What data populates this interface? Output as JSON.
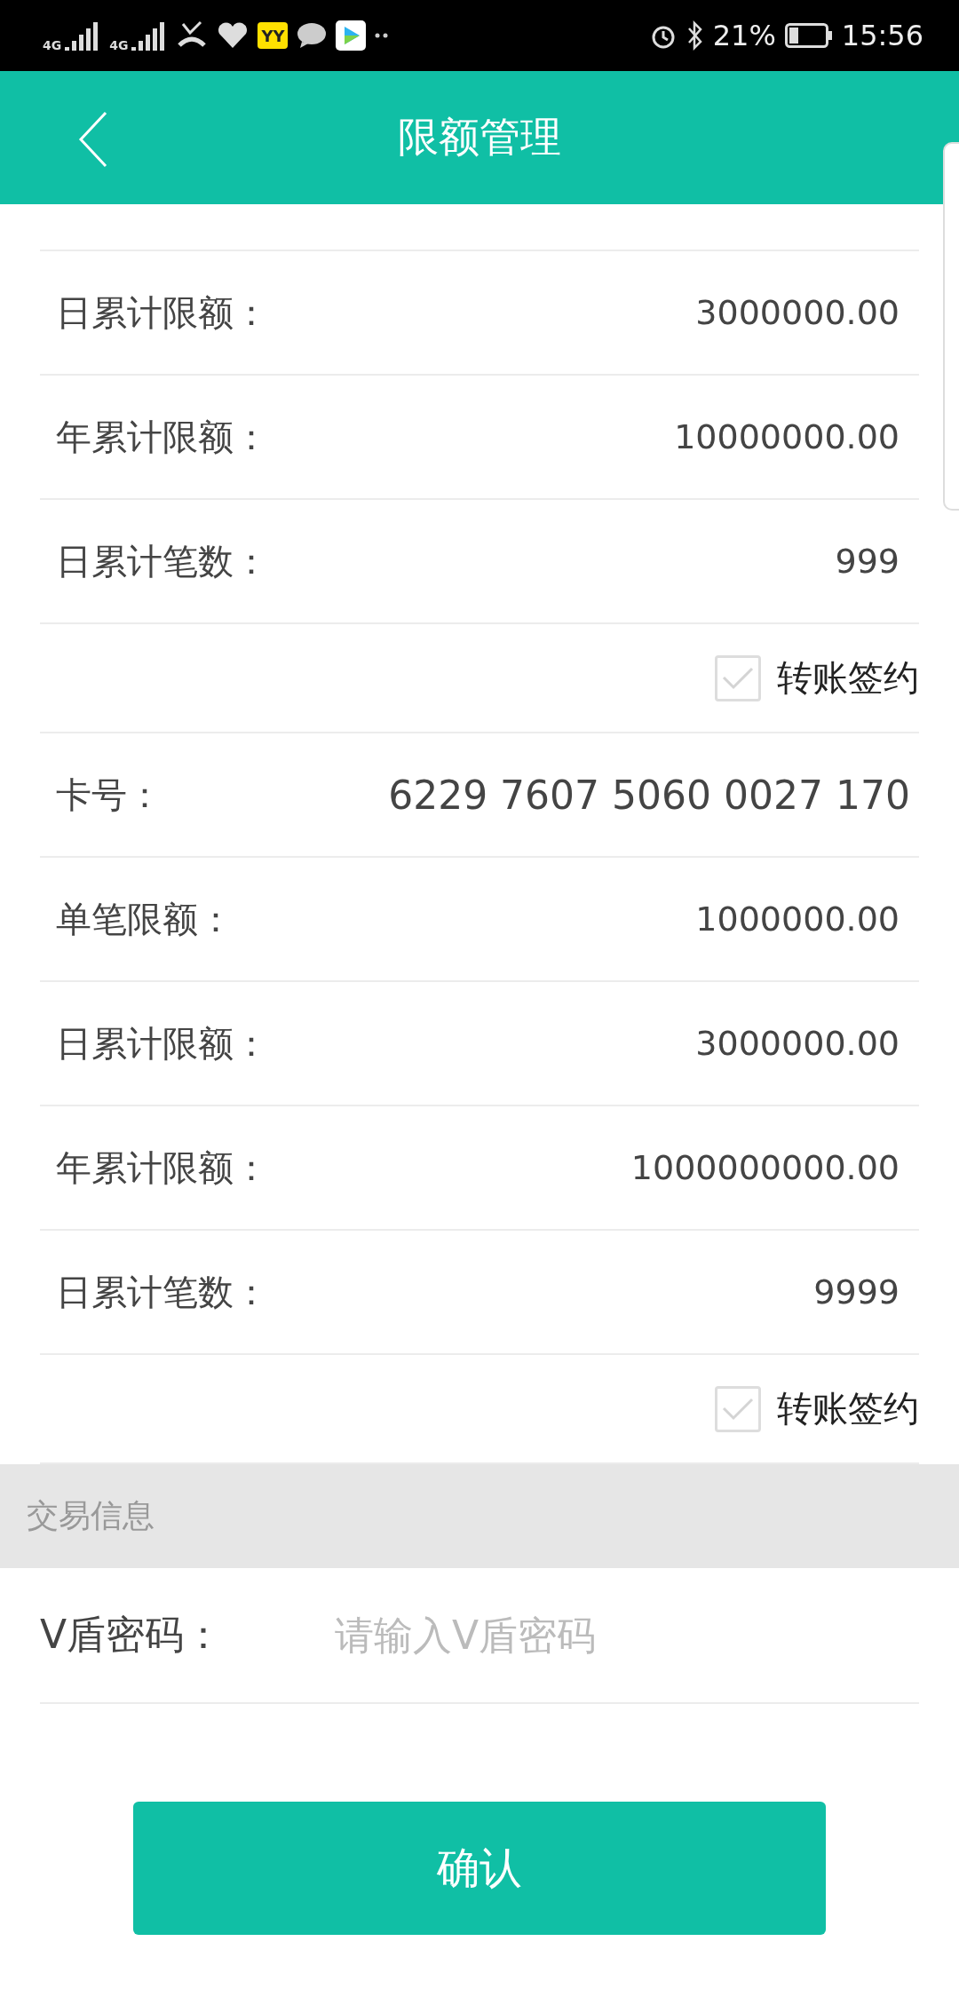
{
  "status_bar": {
    "networks": [
      "4G",
      "4G"
    ],
    "app_badge": "YY",
    "battery": "21%",
    "time": "15:56"
  },
  "header": {
    "title": "限额管理"
  },
  "groups": [
    {
      "rows": [
        {
          "kind": "amount",
          "label": "日累计限额：",
          "value": "3000000.00"
        },
        {
          "kind": "amount",
          "label": "年累计限额：",
          "value": "10000000.00"
        },
        {
          "kind": "amount",
          "label": "日累计笔数：",
          "value": "999"
        }
      ],
      "agreement": {
        "label": "转账签约",
        "checked": true
      }
    },
    {
      "rows": [
        {
          "kind": "card",
          "label": "卡号：",
          "value": "6229 7607 5060 0027 170"
        },
        {
          "kind": "amount",
          "label": "单笔限额：",
          "value": "1000000.00"
        },
        {
          "kind": "amount",
          "label": "日累计限额：",
          "value": "3000000.00"
        },
        {
          "kind": "amount",
          "label": "年累计限额：",
          "value": "1000000000.00"
        },
        {
          "kind": "amount",
          "label": "日累计笔数：",
          "value": "9999"
        }
      ],
      "agreement": {
        "label": "转账签约",
        "checked": true
      }
    }
  ],
  "section": {
    "title": "交易信息"
  },
  "password": {
    "label": "V盾密码：",
    "placeholder": "请输入V盾密码"
  },
  "confirm_button": "确认"
}
